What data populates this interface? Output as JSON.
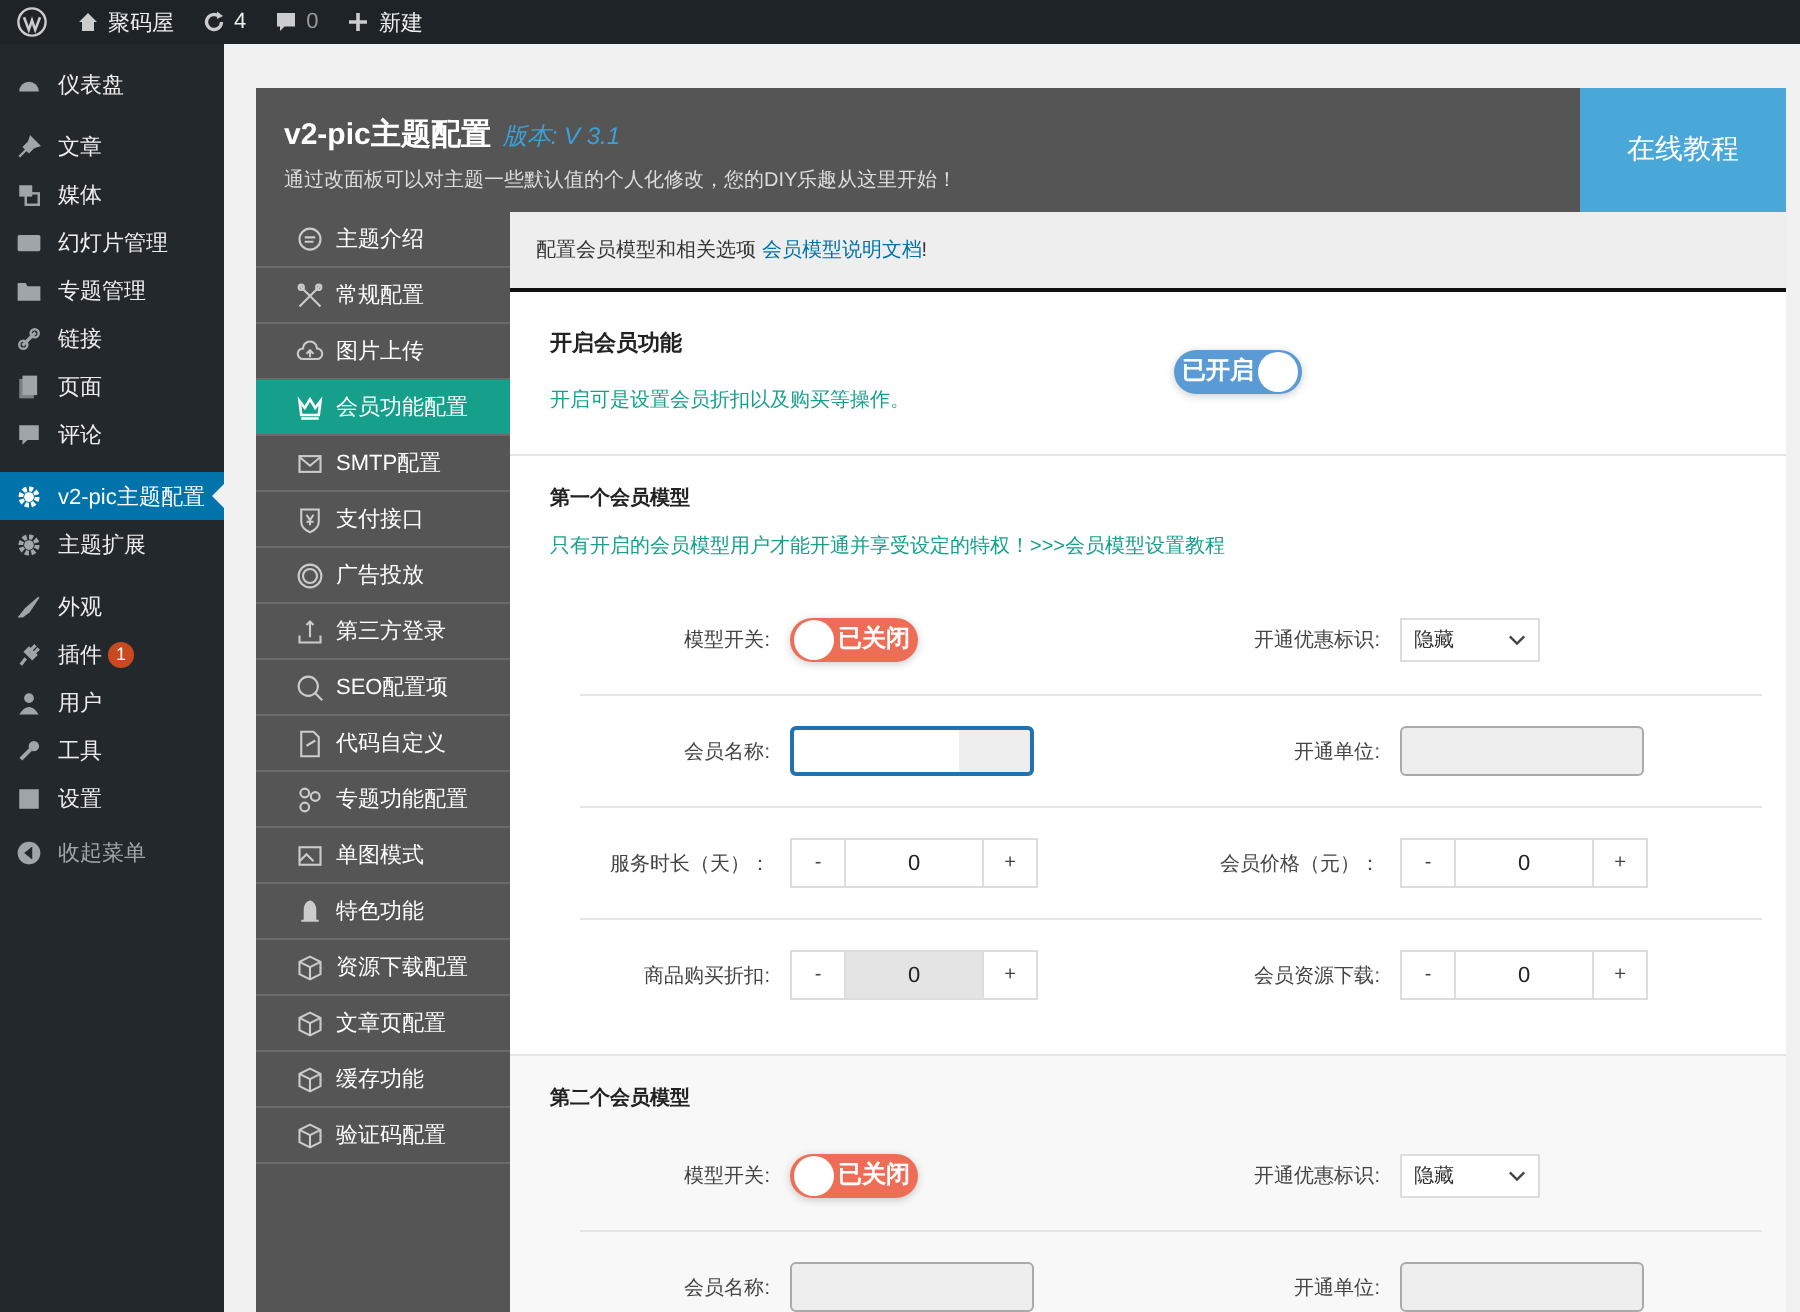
{
  "admin_bar": {
    "site": "聚码屋",
    "updates": "4",
    "comments": "0",
    "new": "新建"
  },
  "sidebar": {
    "groups": [
      [
        {
          "label": "仪表盘",
          "selected": false
        }
      ],
      [
        {
          "label": "文章",
          "selected": false
        },
        {
          "label": "媒体",
          "selected": false
        },
        {
          "label": "幻灯片管理",
          "selected": false
        },
        {
          "label": "专题管理",
          "selected": false
        },
        {
          "label": "链接",
          "selected": false
        },
        {
          "label": "页面",
          "selected": false
        },
        {
          "label": "评论",
          "selected": false
        }
      ],
      [
        {
          "label": "v2-pic主题配置",
          "selected": true
        },
        {
          "label": "主题扩展",
          "selected": false
        }
      ],
      [
        {
          "label": "外观",
          "selected": false
        },
        {
          "label": "插件",
          "selected": false,
          "badge": "1"
        },
        {
          "label": "用户",
          "selected": false
        },
        {
          "label": "工具",
          "selected": false
        },
        {
          "label": "设置",
          "selected": false
        }
      ]
    ],
    "collapse": "收起菜单"
  },
  "panel": {
    "title": "v2-pic主题配置",
    "version": "版本: V 3.1",
    "subtitle": "通过改面板可以对主题一些默认值的个人化修改，您的DIY乐趣从这里开始！",
    "tutorial_button": "在线教程",
    "menu": [
      {
        "label": "主题介绍",
        "selected": false
      },
      {
        "label": "常规配置",
        "selected": false
      },
      {
        "label": "图片上传",
        "selected": false
      },
      {
        "label": "会员功能配置",
        "selected": true
      },
      {
        "label": "SMTP配置",
        "selected": false
      },
      {
        "label": "支付接口",
        "selected": false
      },
      {
        "label": "广告投放",
        "selected": false
      },
      {
        "label": "第三方登录",
        "selected": false
      },
      {
        "label": "SEO配置项",
        "selected": false
      },
      {
        "label": "代码自定义",
        "selected": false
      },
      {
        "label": "专题功能配置",
        "selected": false
      },
      {
        "label": "单图模式",
        "selected": false
      },
      {
        "label": "特色功能",
        "selected": false
      },
      {
        "label": "资源下载配置",
        "selected": false
      },
      {
        "label": "文章页配置",
        "selected": false
      },
      {
        "label": "缓存功能",
        "selected": false
      },
      {
        "label": "验证码配置",
        "selected": false
      }
    ],
    "notice": {
      "text": "配置会员模型和相关选项",
      "link": "会员模型说明文档",
      "suffix": "!"
    },
    "enable": {
      "title": "开启会员功能",
      "description": "开启可是设置会员折扣以及购买等操作。",
      "switch": {
        "text": "已开启",
        "on": true
      }
    },
    "models": [
      {
        "title": "第一个会员模型",
        "notice": "只有开启的会员模型用户才能开通并享受设定的特权！>>>会员模型设置教程",
        "rows": [
          [
            {
              "kind": "switch",
              "label": "模型开关:",
              "on": false,
              "text": "已关闭"
            },
            {
              "kind": "select",
              "label": "开通优惠标识:",
              "value": "隐藏"
            }
          ],
          [
            {
              "kind": "text",
              "label": "会员名称:",
              "focused": true
            },
            {
              "kind": "text",
              "label": "开通单位:",
              "focused": false
            }
          ],
          [
            {
              "kind": "stepper",
              "label": "服务时长（天）：",
              "minus": "-",
              "value": "0",
              "plus": "+",
              "disabled": false
            },
            {
              "kind": "stepper",
              "label": "会员价格（元）：",
              "minus": "-",
              "value": "0",
              "plus": "+",
              "disabled": false
            }
          ],
          [
            {
              "kind": "stepper",
              "label": "商品购买折扣:",
              "minus": "-",
              "value": "0",
              "plus": "+",
              "disabled": true
            },
            {
              "kind": "stepper",
              "label": "会员资源下载:",
              "minus": "-",
              "value": "0",
              "plus": "+",
              "disabled": false
            }
          ]
        ]
      },
      {
        "title": "第二个会员模型",
        "rows": [
          [
            {
              "kind": "switch",
              "label": "模型开关:",
              "on": false,
              "text": "已关闭"
            },
            {
              "kind": "select",
              "label": "开通优惠标识:",
              "value": "隐藏"
            }
          ],
          [
            {
              "kind": "text",
              "label": "会员名称:",
              "focused": false
            },
            {
              "kind": "text",
              "label": "开通单位:",
              "focused": false
            }
          ]
        ]
      }
    ]
  }
}
